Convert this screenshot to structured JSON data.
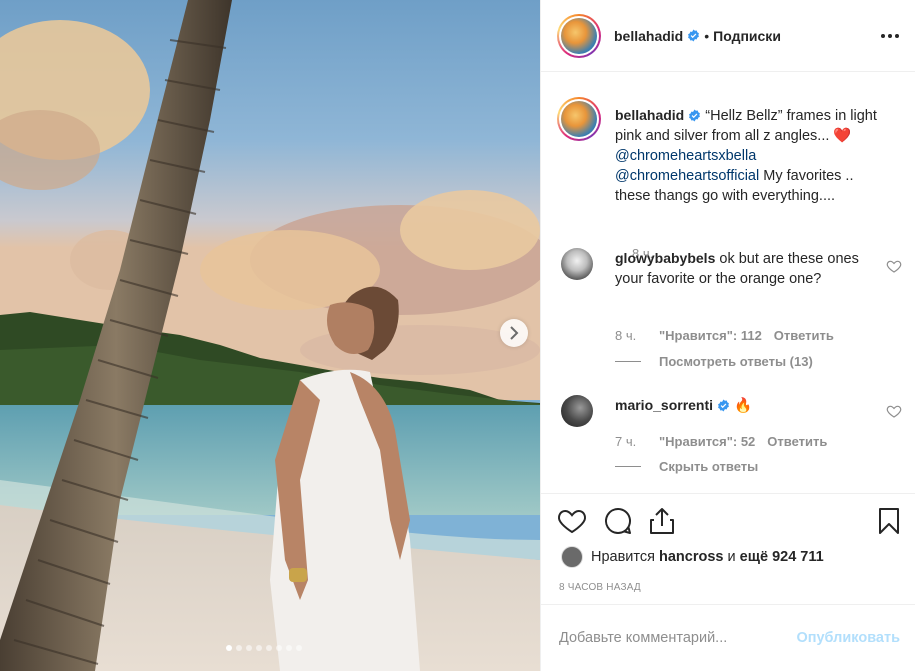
{
  "post": {
    "media_alt": "Photo of a woman in white dress under a palm tree on a beach at sunset",
    "carousel": {
      "total": 8,
      "active": 0
    }
  },
  "header": {
    "username": "bellahadid",
    "separator": "•",
    "follow_label": "Подписки"
  },
  "caption": {
    "username": "bellahadid",
    "text_1": "“Hellz Bellz” frames in light pink and silver from all z angles...",
    "emoji": "❤️",
    "mention_1": "@chromeheartsxbella",
    "mention_2": "@chromeheartsofficial",
    "text_2": "My favorites .. these thangs go with everything....",
    "time": "8 ч."
  },
  "comments": [
    {
      "username": "glowybabybels",
      "text": "ok but are these ones your favorite or the orange one?",
      "time": "8 ч.",
      "likes": "\"Нравится\": 112",
      "reply": "Ответить",
      "replies_toggle": "Посмотреть ответы (13)"
    },
    {
      "username": "mario_sorrenti",
      "text": "🔥",
      "time": "7 ч.",
      "likes": "\"Нравится\": 52",
      "reply": "Ответить",
      "replies_toggle": "Скрыть ответы"
    }
  ],
  "actions": {
    "like_icon": "heart-icon",
    "comment_icon": "comment-icon",
    "share_icon": "share-icon",
    "save_icon": "bookmark-icon"
  },
  "likes": {
    "prefix": "Нравится",
    "user": "hancross",
    "middle": "и",
    "rest": "ещё 924 711"
  },
  "posted_time": "8 ЧАСОВ НАЗАД",
  "add_comment": {
    "placeholder": "Добавьте комментарий...",
    "publish_label": "Опубликовать"
  },
  "colors": {
    "verified": "#3897f0",
    "link": "#00376b",
    "muted": "#8e8e8e",
    "publish_disabled": "#b2dffc",
    "heart_red": "#ed4956"
  }
}
